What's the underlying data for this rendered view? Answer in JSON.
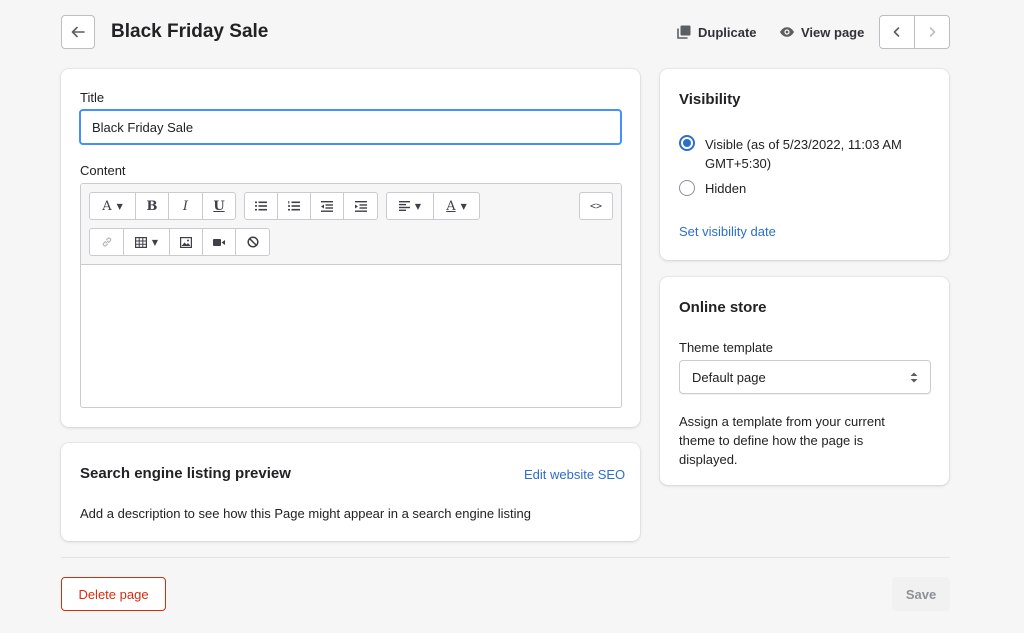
{
  "header": {
    "title": "Black Friday Sale",
    "duplicate_label": "Duplicate",
    "view_page_label": "View page"
  },
  "page_form": {
    "title_label": "Title",
    "title_value": "Black Friday Sale",
    "content_label": "Content"
  },
  "seo": {
    "heading": "Search engine listing preview",
    "edit_link": "Edit website SEO",
    "description": "Add a description to see how this Page might appear in a search engine listing"
  },
  "visibility": {
    "heading": "Visibility",
    "visible_label_line1": "Visible (as of 5/23/2022, 11:03 AM",
    "visible_label_line2": "GMT+5:30)",
    "hidden_label": "Hidden",
    "selected": "visible",
    "set_date_link": "Set visibility date"
  },
  "online_store": {
    "heading": "Online store",
    "template_label": "Theme template",
    "template_value": "Default page",
    "help_line1": "Assign a template from your current",
    "help_line2": "theme to define how the page is",
    "help_line3": "displayed."
  },
  "footer": {
    "delete_label": "Delete page",
    "save_label": "Save"
  },
  "editor_toolbar": {
    "font_glyph": "A",
    "bold_glyph": "B",
    "italic_glyph": "I",
    "underline_glyph": "U",
    "text_color_glyph": "A",
    "code_glyph": "<>"
  },
  "colors": {
    "accent": "#2c6ecb",
    "danger": "#d72c0d",
    "focus_border": "#458fff",
    "background": "#f6f6f7"
  }
}
